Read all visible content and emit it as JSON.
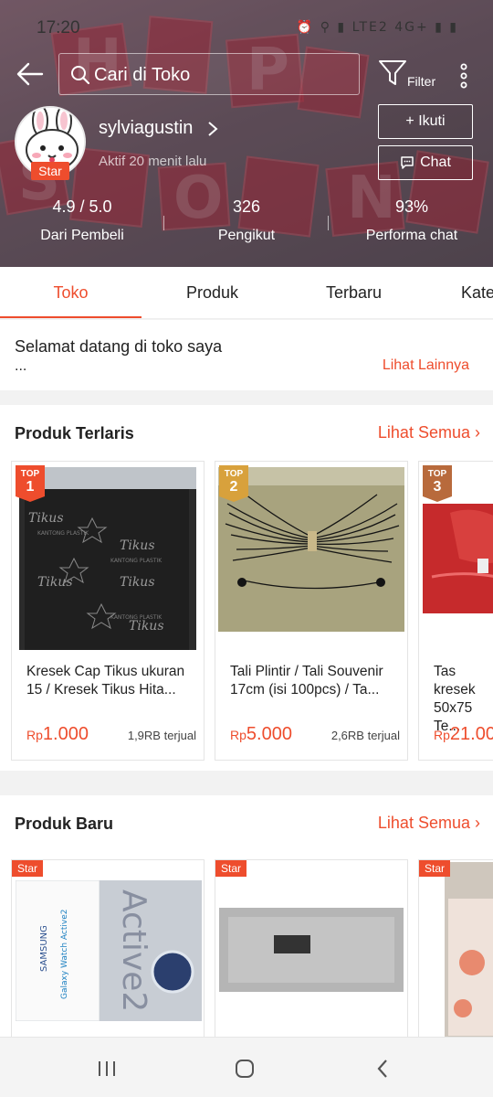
{
  "status_bar": {
    "time": "17:20",
    "icons": "⏰ ⚲ ▮ LTE2 4G+ ▮ ▮"
  },
  "header": {
    "search_placeholder": "Cari di Toko",
    "filter_label": "Filter",
    "banner_text": "HAPPY SHOPPING"
  },
  "shop": {
    "name": "sylviagustin",
    "active": "Aktif 20 menit lalu",
    "badge": "Star",
    "follow_label": "+ Ikuti",
    "chat_label": "Chat"
  },
  "stats": [
    {
      "value": "4.9 / 5.0",
      "label": "Dari Pembeli"
    },
    {
      "value": "326",
      "label": "Pengikut"
    },
    {
      "value": "93%",
      "label": "Performa chat"
    }
  ],
  "tabs": [
    "Toko",
    "Produk",
    "Terbaru",
    "Kategori"
  ],
  "welcome": {
    "title": "Selamat datang di toko saya",
    "ellipsis": "...",
    "link": "Lihat Lainnya"
  },
  "best_sellers": {
    "title": "Produk Terlaris",
    "link": "Lihat Semua",
    "items": [
      {
        "rank_label": "TOP",
        "rank": "1",
        "name": "Kresek Cap Tikus ukuran 15 / Kresek Tikus Hita...",
        "currency": "Rp",
        "price": "1.000",
        "sold": "1,9RB terjual",
        "rank_color": "#ee4d2d"
      },
      {
        "rank_label": "TOP",
        "rank": "2",
        "name": "Tali Plintir / Tali Souvenir 17cm (isi 100pcs) / Ta...",
        "currency": "Rp",
        "price": "5.000",
        "sold": "2,6RB terjual",
        "rank_color": "#d8a13c"
      },
      {
        "rank_label": "TOP",
        "rank": "3",
        "name": "Tas kresek 50x75 Te...",
        "currency": "Rp",
        "price": "21.00",
        "sold": "",
        "rank_color": "#b86a3c"
      }
    ]
  },
  "new_products": {
    "title": "Produk Baru",
    "link": "Lihat Semua",
    "items": [
      {
        "badge": "Star",
        "box_brand": "SAMSUNG",
        "box_model": "Galaxy Watch Active2",
        "box_side": "Active2"
      },
      {
        "badge": "Star"
      },
      {
        "badge": "Star"
      }
    ]
  },
  "image_text": {
    "kresek_brand": "Tikus",
    "kresek_maker": "KANTONG PLASTIK"
  }
}
